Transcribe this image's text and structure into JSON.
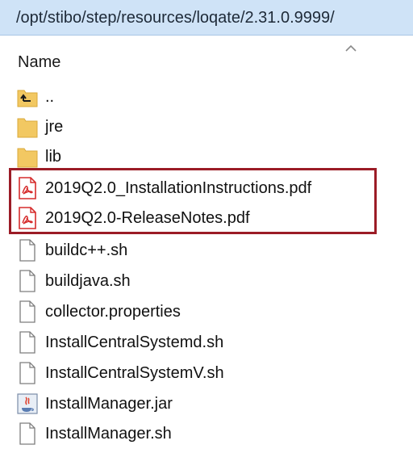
{
  "path_bar": {
    "path": "/opt/stibo/step/resources/loqate/2.31.0.9999/"
  },
  "header": {
    "name_column": "Name",
    "sort_icon": "chevron-up-icon"
  },
  "files": [
    {
      "name": "..",
      "type": "parent-folder"
    },
    {
      "name": "jre",
      "type": "folder"
    },
    {
      "name": "lib",
      "type": "folder"
    },
    {
      "name": "2019Q2.0_InstallationInstructions.pdf",
      "type": "pdf"
    },
    {
      "name": "2019Q2.0-ReleaseNotes.pdf",
      "type": "pdf"
    },
    {
      "name": "buildc++.sh",
      "type": "file"
    },
    {
      "name": "buildjava.sh",
      "type": "file"
    },
    {
      "name": "collector.properties",
      "type": "file"
    },
    {
      "name": "InstallCentralSystemd.sh",
      "type": "file"
    },
    {
      "name": "InstallCentralSystemV.sh",
      "type": "file"
    },
    {
      "name": "InstallManager.jar",
      "type": "jar"
    },
    {
      "name": "InstallManager.sh",
      "type": "file"
    }
  ],
  "colors": {
    "path_bar_bg": "#cfe3f7",
    "highlight_border": "#9b1c26",
    "folder": "#f2c862",
    "pdf_red": "#d62b2b"
  }
}
